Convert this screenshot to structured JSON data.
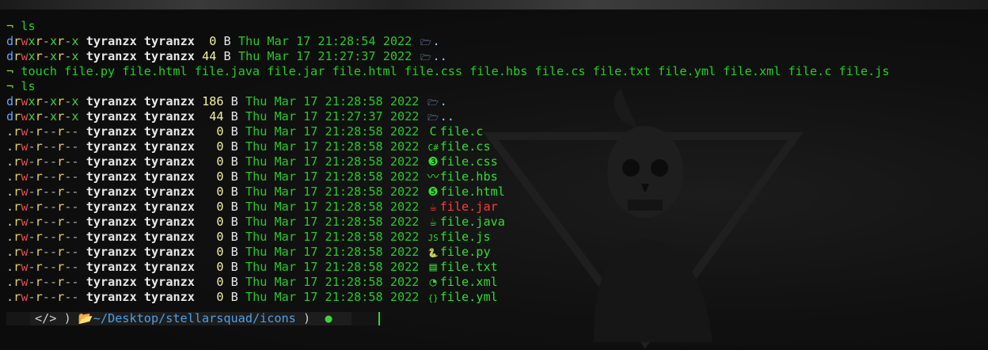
{
  "prompt_symbol": "¬",
  "blocks": [
    {
      "command": "ls",
      "entries": [
        {
          "perm": "drwxr-xr-x",
          "owner": "tyranzx",
          "group": "tyranzx",
          "size": " 0",
          "unit": "B",
          "date": "Thu Mar 17 21:28:54 2022",
          "icon": "folder-open-icon",
          "name": "."
        },
        {
          "perm": "drwxr-xr-x",
          "owner": "tyranzx",
          "group": "tyranzx",
          "size": "44",
          "unit": "B",
          "date": "Thu Mar 17 21:27:37 2022",
          "icon": "folder-open-icon",
          "name": ".."
        }
      ]
    },
    {
      "command": "touch file.py file.html file.java file.jar file.html file.css file.hbs file.cs file.txt file.yml file.xml file.c file.js"
    },
    {
      "command": "ls",
      "entries": [
        {
          "perm": "drwxr-xr-x",
          "owner": "tyranzx",
          "group": "tyranzx",
          "size": "186",
          "unit": "B",
          "date": "Thu Mar 17 21:28:58 2022",
          "icon": "folder-open-icon",
          "name": "."
        },
        {
          "perm": "drwxr-xr-x",
          "owner": "tyranzx",
          "group": "tyranzx",
          "size": " 44",
          "unit": "B",
          "date": "Thu Mar 17 21:27:37 2022",
          "icon": "folder-open-icon",
          "name": ".."
        },
        {
          "perm": ".rw-r--r--",
          "owner": "tyranzx",
          "group": "tyranzx",
          "size": "  0",
          "unit": "B",
          "date": "Thu Mar 17 21:28:58 2022",
          "icon": "c-lang-icon",
          "name": "file.c"
        },
        {
          "perm": ".rw-r--r--",
          "owner": "tyranzx",
          "group": "tyranzx",
          "size": "  0",
          "unit": "B",
          "date": "Thu Mar 17 21:28:58 2022",
          "icon": "csharp-icon",
          "name": "file.cs"
        },
        {
          "perm": ".rw-r--r--",
          "owner": "tyranzx",
          "group": "tyranzx",
          "size": "  0",
          "unit": "B",
          "date": "Thu Mar 17 21:28:58 2022",
          "icon": "css3-icon",
          "name": "file.css"
        },
        {
          "perm": ".rw-r--r--",
          "owner": "tyranzx",
          "group": "tyranzx",
          "size": "  0",
          "unit": "B",
          "date": "Thu Mar 17 21:28:58 2022",
          "icon": "mustache-icon",
          "name": "file.hbs"
        },
        {
          "perm": ".rw-r--r--",
          "owner": "tyranzx",
          "group": "tyranzx",
          "size": "  0",
          "unit": "B",
          "date": "Thu Mar 17 21:28:58 2022",
          "icon": "html5-icon",
          "name": "file.html"
        },
        {
          "perm": ".rw-r--r--",
          "owner": "tyranzx",
          "group": "tyranzx",
          "size": "  0",
          "unit": "B",
          "date": "Thu Mar 17 21:28:58 2022",
          "icon": "java-cup-icon",
          "name": "file.jar"
        },
        {
          "perm": ".rw-r--r--",
          "owner": "tyranzx",
          "group": "tyranzx",
          "size": "  0",
          "unit": "B",
          "date": "Thu Mar 17 21:28:58 2022",
          "icon": "java-cup-icon",
          "name": "file.java"
        },
        {
          "perm": ".rw-r--r--",
          "owner": "tyranzx",
          "group": "tyranzx",
          "size": "  0",
          "unit": "B",
          "date": "Thu Mar 17 21:28:58 2022",
          "icon": "javascript-icon",
          "name": "file.js"
        },
        {
          "perm": ".rw-r--r--",
          "owner": "tyranzx",
          "group": "tyranzx",
          "size": "  0",
          "unit": "B",
          "date": "Thu Mar 17 21:28:58 2022",
          "icon": "python-icon",
          "name": "file.py"
        },
        {
          "perm": ".rw-r--r--",
          "owner": "tyranzx",
          "group": "tyranzx",
          "size": "  0",
          "unit": "B",
          "date": "Thu Mar 17 21:28:58 2022",
          "icon": "text-file-icon",
          "name": "file.txt"
        },
        {
          "perm": ".rw-r--r--",
          "owner": "tyranzx",
          "group": "tyranzx",
          "size": "  0",
          "unit": "B",
          "date": "Thu Mar 17 21:28:58 2022",
          "icon": "rss-icon",
          "name": "file.xml"
        },
        {
          "perm": ".rw-r--r--",
          "owner": "tyranzx",
          "group": "tyranzx",
          "size": "  0",
          "unit": "B",
          "date": "Thu Mar 17 21:28:58 2022",
          "icon": "braces-icon",
          "name": "file.yml"
        }
      ]
    }
  ],
  "statusbar": {
    "code_icon": "</>",
    "path_icon": "folder-open-icon",
    "path": "~/Desktop/stellarsquad/icons",
    "separator": ")",
    "status_dot": "●"
  },
  "colors": {
    "background": "#0d0d0d",
    "prompt": "#8ed62a",
    "date": "#29c829",
    "filename": "#2ede2e",
    "directory": "#9fc3ff",
    "archive": "#ff3b3b"
  }
}
